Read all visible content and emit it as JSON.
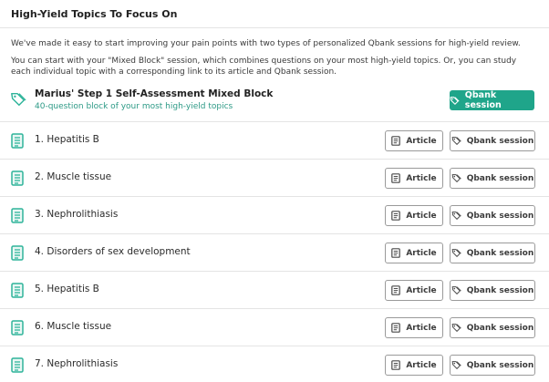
{
  "header": {
    "title": "High-Yield Topics To Focus On"
  },
  "intro": {
    "paragraph_1": "We've made it easy to start improving your pain points with two types of personalized Qbank sessions for high-yield review.",
    "paragraph_2": "You can start with your \"Mixed Block\" session, which combines questions on your most high-yield topics. Or, you can study each individual topic with a corresponding link to its article and Qbank session."
  },
  "mixed_block": {
    "title": "Marius' Step 1 Self-Assessment Mixed Block",
    "subtitle": "40-question block of your most high-yield topics",
    "button_label": "Qbank session"
  },
  "buttons": {
    "article_label": "Article",
    "qbank_label": "Qbank session"
  },
  "topics": [
    {
      "label": "1. Hepatitis B"
    },
    {
      "label": "2. Muscle tissue"
    },
    {
      "label": "3. Nephrolithiasis"
    },
    {
      "label": "4. Disorders of sex development"
    },
    {
      "label": "5. Hepatitis B"
    },
    {
      "label": "6. Muscle tissue"
    },
    {
      "label": "7. Nephrolithiasis"
    }
  ],
  "colors": {
    "accent": "#1fa58a",
    "icon": "#2fb49a",
    "subtitle": "#2d9a86"
  },
  "icons": {
    "mixed_block": "tags-icon",
    "topic": "document-icon",
    "article": "article-icon",
    "qbank": "tags-icon"
  }
}
